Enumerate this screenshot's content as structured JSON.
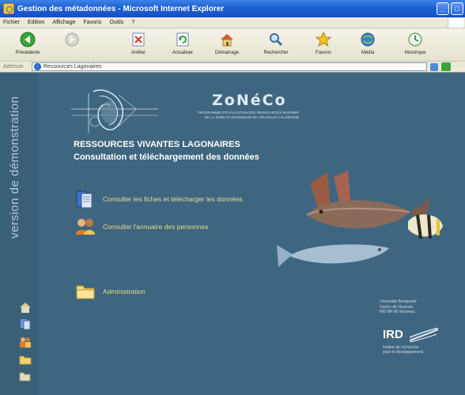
{
  "window": {
    "title": "Gestion des métadonnées - Microsoft Internet Explorer",
    "controls": [
      "_",
      "□"
    ]
  },
  "menu": [
    "Fichier",
    "Edition",
    "Affichage",
    "Favoris",
    "Outils",
    "?"
  ],
  "toolbar": {
    "back": "Précédente",
    "stop": "Arrêter",
    "refresh": "Actualiser",
    "home": "Démarrage",
    "search": "Rechercher",
    "favorites": "Favoris",
    "media": "Média",
    "history": "Historique"
  },
  "address": {
    "label": "Adresse",
    "value": "Ressources Lagonaires"
  },
  "side": {
    "vertical_text": "version de démonstration",
    "icons": [
      "home-icon",
      "documents-icon",
      "people-icon",
      "folder-icon",
      "folder-open-icon"
    ]
  },
  "brand": {
    "name": "ZoNéCo",
    "subtitle_lines": [
      "PROGRAMME D'ÉVALUATION DES RESSOURCES MARINES",
      "DE LA ZONE ÉCONOMIQUE DE NOUVELLE-CALÉDONIE"
    ]
  },
  "main": {
    "heading1": "RESSOURCES VIVANTES LAGONAIRES",
    "heading2": "Consultation et téléchargement des données",
    "links": [
      {
        "label": "Consulter les fiches et télécharger les données",
        "icon": "documents-icon"
      },
      {
        "label": "Consulter l'annuaire des personnes",
        "icon": "people-icon"
      },
      {
        "label": "Administration",
        "icon": "folder-icon"
      }
    ]
  },
  "ird": {
    "address_lines": [
      "Université Bonaparte",
      "Centre de Nouméa",
      "IRD BP A5 Nouméa"
    ],
    "logo": "IRD",
    "caption_lines": [
      "Institut de recherche",
      "pour le développement"
    ]
  },
  "colors": {
    "content_bg": "#3e6680",
    "link_text": "#f0d98e",
    "titlebar": "#1d5fd1"
  }
}
